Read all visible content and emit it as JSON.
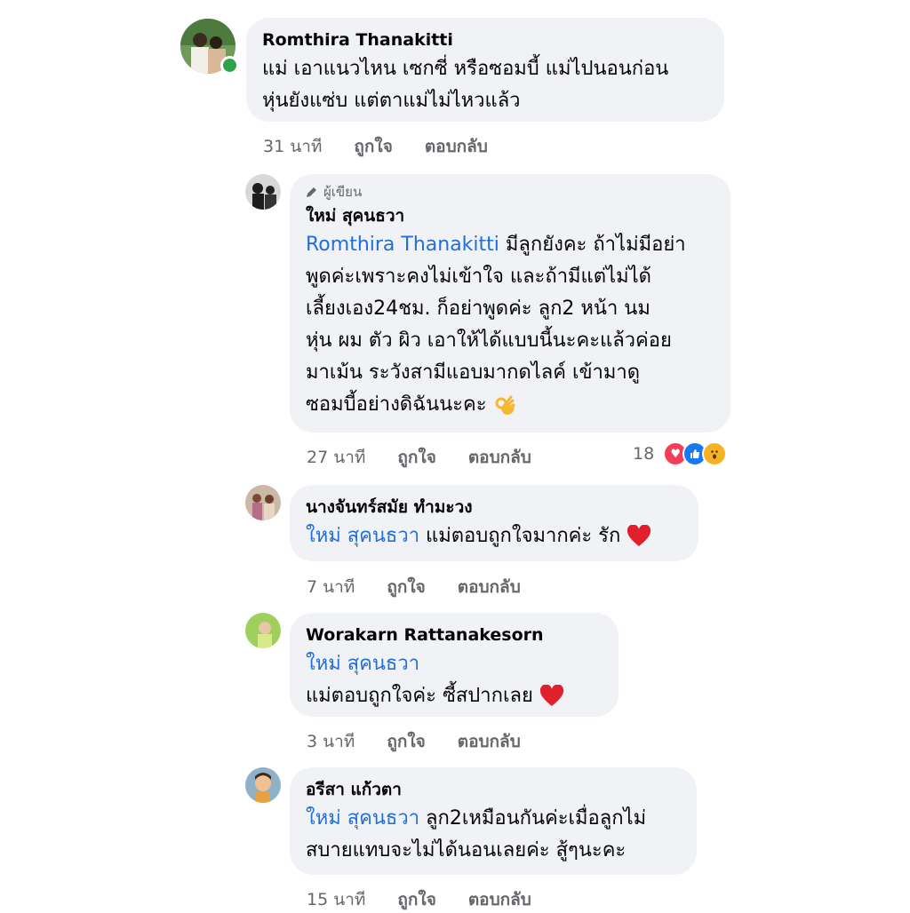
{
  "comments": [
    {
      "name": "Romthira Thanakitti",
      "lines": [
        "แม่ เอาแนวไหน เซกซี่ หรือซอมบี้ แม่ไปนอนก่อน",
        "หุ่นยังแซ่บ แต่ตาแม่ไม่ไหวแล้ว"
      ],
      "time": "31 นาที",
      "like": "ถูกใจ",
      "reply": "ตอบกลับ"
    },
    {
      "badge": "ผู้เขียน",
      "name": "ใหม่ สุคนธวา",
      "mention": "Romthira Thanakitti",
      "first_line_rest": " มีลูกยังคะ ถ้าไม่มีอย่า",
      "lines": [
        "พูดค่ะเพราะคงไม่เข้าใจ และถ้ามีแต่ไม่ได้",
        "เลี้ยงเอง24ชม. ก็อย่าพูดค่ะ ลูก2 หน้า นม",
        "หุ่น ผม ตัว ผิว เอาให้ได้แบบนี้นะคะแล้วค่อย",
        "มาเม้น ระวังสามีแอบมากดไลค์ เข้ามาดู",
        "ซอมบี้อย่างดิฉันนะคะ"
      ],
      "time": "27 นาที",
      "like": "ถูกใจ",
      "reply": "ตอบกลับ",
      "reaction_count": "18"
    },
    {
      "name": "นางจันทร์สมัย ทำมะวง",
      "mention": "ใหม่ สุคนธวา",
      "first_line_rest": " แม่ตอบถูกใจมากค่ะ รัก",
      "time": "7 นาที",
      "like": "ถูกใจ",
      "reply": "ตอบกลับ"
    },
    {
      "name": "Worakarn Rattanakesorn",
      "mention": "ใหม่ สุคนธวา",
      "lines": [
        "แม่ตอบถูกใจค่ะ ซี้สปากเลย"
      ],
      "time": "3 นาที",
      "like": "ถูกใจ",
      "reply": "ตอบกลับ"
    },
    {
      "name": "อรีสา แก้วตา",
      "mention": "ใหม่ สุคนธวา",
      "first_line_rest": " ลูก2เหมือนกันค่ะเมื่อลูกไม่",
      "lines": [
        "สบายแทบจะไม่ได้นอนเลยค่ะ สู้ๆนะคะ"
      ],
      "time": "15 นาที",
      "like": "ถูกใจ",
      "reply": "ตอบกลับ"
    }
  ],
  "colors": {
    "bubble": "#f0f2f5",
    "mention": "#216fdb",
    "meta": "#65676b",
    "online": "#31a24c",
    "love": "#f33e58",
    "like": "#1877f2",
    "wow": "#f7b125"
  },
  "icons": [
    "pencil-icon",
    "ok-hand-emoji",
    "red-heart-emoji",
    "love-reaction-icon",
    "like-reaction-icon",
    "wow-reaction-icon"
  ]
}
